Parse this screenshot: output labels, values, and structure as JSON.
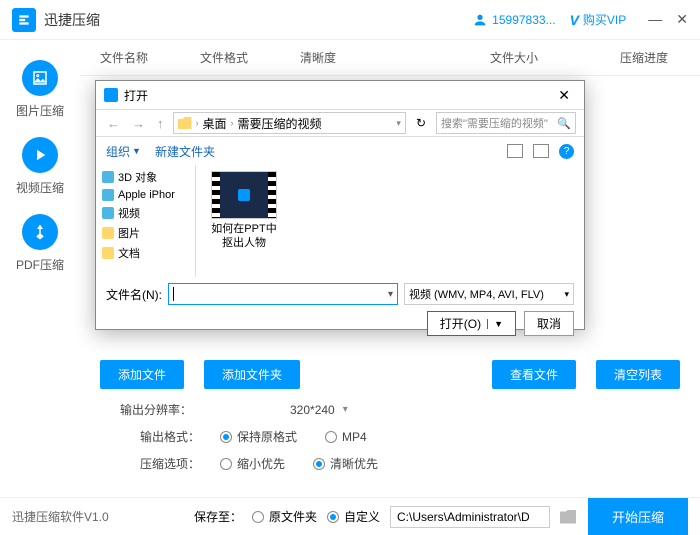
{
  "app": {
    "title": "迅捷压缩",
    "user_id": "15997833...",
    "vip_label": "购买VIP"
  },
  "sidebar": [
    {
      "label": "图片压缩"
    },
    {
      "label": "视频压缩"
    },
    {
      "label": "PDF压缩"
    }
  ],
  "table": {
    "headers": [
      "文件名称",
      "文件格式",
      "清晰度",
      "文件大小",
      "压缩进度"
    ]
  },
  "actions": {
    "add_file": "添加文件",
    "add_folder": "添加文件夹",
    "view_file": "查看文件",
    "clear_list": "清空列表"
  },
  "settings": {
    "resolution_label": "输出分辨率：",
    "resolution_value": "320*240",
    "format_label": "输出格式：",
    "format_opts": [
      "保持原格式",
      "MP4"
    ],
    "option_label": "压缩选项：",
    "option_opts": [
      "缩小优先",
      "清晰优先"
    ]
  },
  "footer": {
    "version": "迅捷压缩软件V1.0",
    "save_label": "保存至：",
    "save_opts": [
      "原文件夹",
      "自定义"
    ],
    "path": "C:\\Users\\Administrator\\D",
    "start": "开始压缩"
  },
  "dialog": {
    "title": "打开",
    "breadcrumb": [
      "桌面",
      "需要压缩的视频"
    ],
    "search_placeholder": "搜索\"需要压缩的视频\"",
    "organize": "组织",
    "new_folder": "新建文件夹",
    "tree": [
      "3D 对象",
      "Apple iPhor",
      "视频",
      "图片",
      "文档"
    ],
    "file_name": "如何在PPT中抠出人物",
    "filename_label": "文件名(N):",
    "type_filter": "视频 (WMV, MP4, AVI, FLV)",
    "open_btn": "打开(O)",
    "cancel_btn": "取消"
  }
}
